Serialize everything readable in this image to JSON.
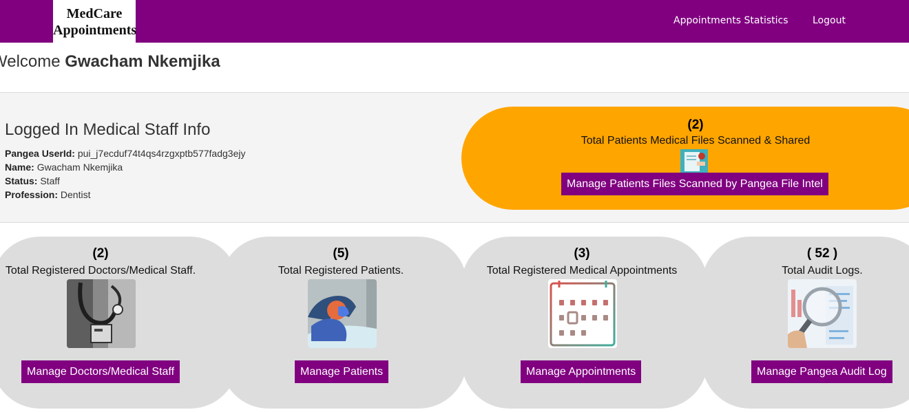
{
  "navbar": {
    "brand_line1": "MedCare",
    "brand_line2": "Appointments",
    "links": [
      "Appointments Statistics",
      "Logout"
    ],
    "background": "#800080"
  },
  "welcome": {
    "prefix": "Welcome",
    "user_name": "Gwacham Nkemjika"
  },
  "staff_info": {
    "title": "Logged In Medical Staff Info",
    "rows": [
      {
        "label": "Pangea UserId:",
        "value": "pui_j7ecduf74t4qs4rzgxptb577fadg3ejy"
      },
      {
        "label": "Name:",
        "value": "Gwacham Nkemjika"
      },
      {
        "label": "Status:",
        "value": "Staff"
      },
      {
        "label": "Profession:",
        "value": "Dentist"
      }
    ]
  },
  "scan_card": {
    "count": "(2)",
    "label": "Total Patients Medical Files Scanned & Shared",
    "button": "Manage Patients Files Scanned by Pangea File Intel",
    "icon": "medical-files-icon",
    "color": "#ffa500"
  },
  "stats": [
    {
      "count": "(2)",
      "label": "Total Registered Doctors/Medical Staff.",
      "button": "Manage Doctors/Medical Staff",
      "icon": "stethoscope-icon"
    },
    {
      "count": "(5)",
      "label": "Total Registered Patients.",
      "button": "Manage Patients",
      "icon": "patient-icon"
    },
    {
      "count": "(3)",
      "label": "Total Registered Medical Appointments",
      "button": "Manage Appointments",
      "icon": "calendar-icon"
    },
    {
      "count": "( 52 )",
      "label": "Total Audit Logs.",
      "button": "Manage Pangea Audit Log",
      "icon": "audit-magnifier-icon"
    }
  ]
}
